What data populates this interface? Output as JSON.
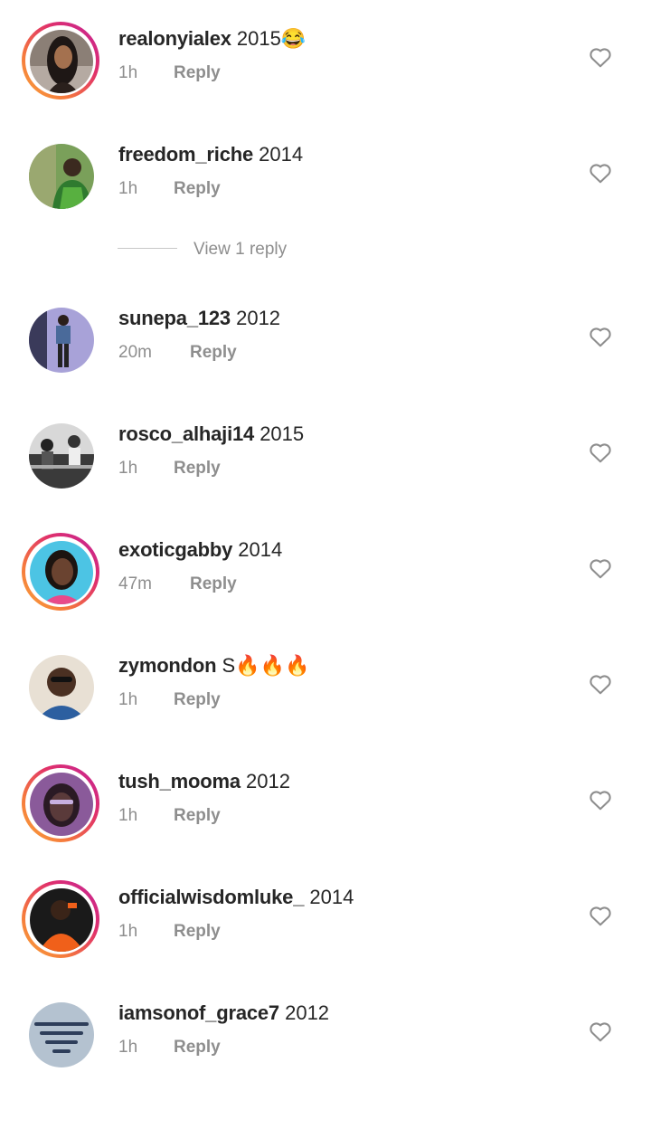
{
  "comments": [
    {
      "username": "realonyialex",
      "text": "2015😂",
      "time": "1h",
      "reply_label": "Reply",
      "has_story": true,
      "avatar_color": "#6d5a52"
    },
    {
      "username": "freedom_riche",
      "text": "2014",
      "time": "1h",
      "reply_label": "Reply",
      "has_story": false,
      "avatar_color": "#4a7a3a"
    },
    {
      "username": "sunepa_123",
      "text": "2012",
      "time": "20m",
      "reply_label": "Reply",
      "has_story": false,
      "avatar_color": "#a8a2d8"
    },
    {
      "username": "rosco_alhaji14",
      "text": "2015",
      "time": "1h",
      "reply_label": "Reply",
      "has_story": false,
      "avatar_color": "#555555"
    },
    {
      "username": "exoticgabby",
      "text": "2014",
      "time": "47m",
      "reply_label": "Reply",
      "has_story": true,
      "avatar_color": "#3db3d8"
    },
    {
      "username": "zymondon",
      "text": "S🔥🔥🔥",
      "time": "1h",
      "reply_label": "Reply",
      "has_story": false,
      "avatar_color": "#3a6fb0"
    },
    {
      "username": "tush_mooma",
      "text": "2012",
      "time": "1h",
      "reply_label": "Reply",
      "has_story": true,
      "avatar_color": "#7a4a8a"
    },
    {
      "username": "officialwisdomluke_",
      "text": "2014",
      "time": "1h",
      "reply_label": "Reply",
      "has_story": true,
      "avatar_color": "#e85a1a"
    },
    {
      "username": "iamsonof_grace7",
      "text": "2012",
      "time": "1h",
      "reply_label": "Reply",
      "has_story": false,
      "avatar_color": "#a9b8c8"
    }
  ],
  "view_replies": {
    "label": "View 1 reply"
  },
  "icons": {
    "like": "heart-outline-icon"
  },
  "colors": {
    "story_ring_start": "#f9a53a",
    "story_ring_end": "#c2239a",
    "text": "#262626",
    "muted": "#8e8e8e"
  }
}
